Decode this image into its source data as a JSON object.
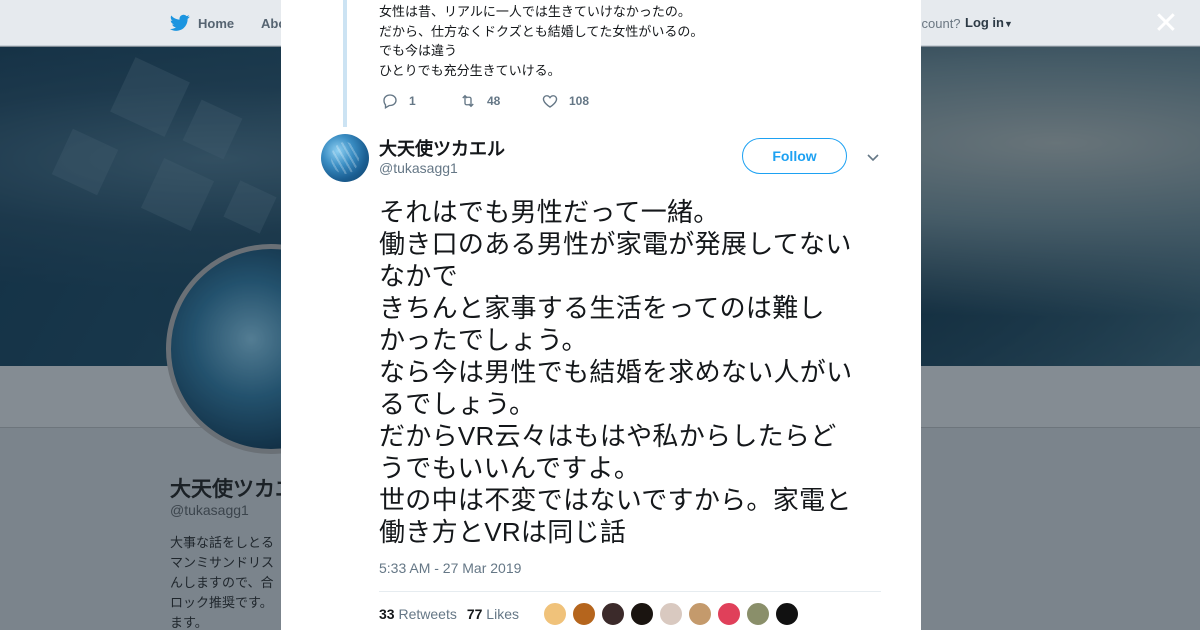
{
  "topbar": {
    "home_label": "Home",
    "about_label": "Abo",
    "account_question": "ccount?",
    "login_label": "Log in"
  },
  "background_profile": {
    "name": "大天使ツカエ",
    "handle": "@tukasagg1",
    "bio_lines": [
      "大事な話をしとる",
      "マンミサンドリス",
      "んしますので、合",
      "ロック推奨です。",
      "ます。"
    ]
  },
  "parent_tweet": {
    "lines": [
      "女性は昔、リアルに一人では生きていけなかったの。",
      "だから、仕方なくドクズとも結婚してた女性がいるの。",
      "でも今は違う",
      "ひとりでも充分生きていける。"
    ],
    "reply_count": "1",
    "retweet_count": "48",
    "like_count": "108"
  },
  "tweet": {
    "display_name": "大天使ツカエル",
    "handle": "@tukasagg1",
    "follow_label": "Follow",
    "text_lines": [
      "それはでも男性だって一緒。",
      "働き口のある男性が家電が発展してない",
      "なかで",
      "きちんと家事する生活をってのは難し",
      "かったでしょう。",
      "なら今は男性でも結婚を求めない人がい",
      "るでしょう。",
      "だからVR云々はもはや私からしたらど",
      "うでもいいんですよ。",
      "世の中は不変ではないですから。家電と",
      "働き方とVRは同じ話"
    ],
    "timestamp": "5:33 AM - 27 Mar 2019",
    "retweets_count": "33",
    "retweets_label": "Retweets",
    "likes_count": "77",
    "likes_label": "Likes",
    "liker_avatars": [
      {
        "name": "liker-avatar-1",
        "color": "#f0c27a"
      },
      {
        "name": "liker-avatar-2",
        "color": "#b5651d"
      },
      {
        "name": "liker-avatar-3",
        "color": "#3b2a2a"
      },
      {
        "name": "liker-avatar-4",
        "color": "#1a1410"
      },
      {
        "name": "liker-avatar-5",
        "color": "#d9c9c0"
      },
      {
        "name": "liker-avatar-6",
        "color": "#c49a6c"
      },
      {
        "name": "liker-avatar-7",
        "color": "#e0405a"
      },
      {
        "name": "liker-avatar-8",
        "color": "#8a8f6a"
      },
      {
        "name": "liker-avatar-9",
        "color": "#111111"
      }
    ]
  },
  "colors": {
    "accent": "#1da1f2",
    "text_primary": "#14171a",
    "text_secondary": "#657786"
  }
}
